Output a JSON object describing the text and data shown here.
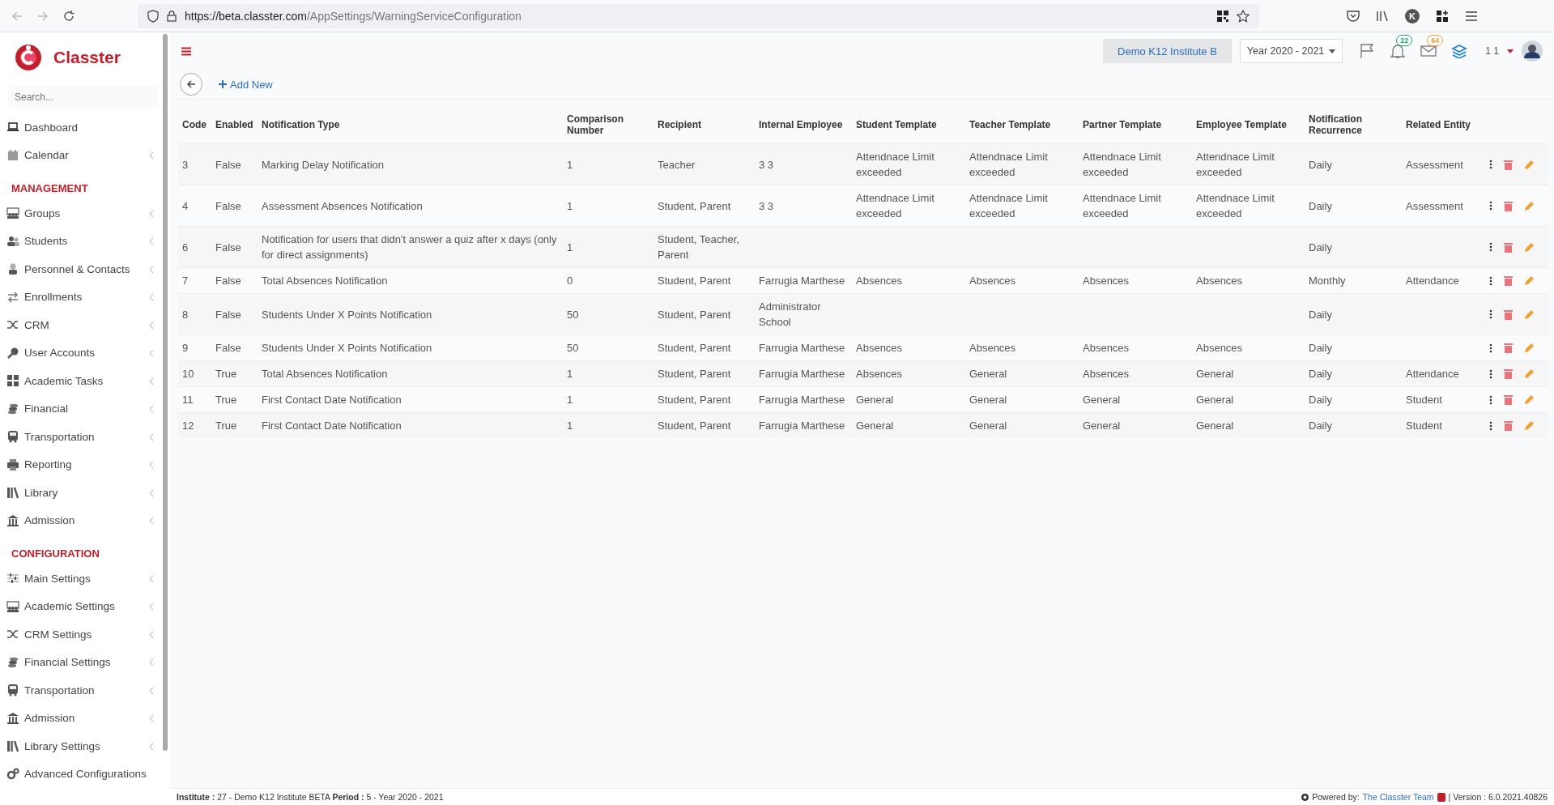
{
  "browser": {
    "url_host": "https://beta.classter.com",
    "url_path": "/AppSettings/WarningServiceConfiguration",
    "profile_initial": "K"
  },
  "sidebar": {
    "brand": "Classter",
    "search_placeholder": "Search...",
    "sections": [
      {
        "items": [
          {
            "label": "Dashboard",
            "expandable": false
          },
          {
            "label": "Calendar",
            "expandable": true
          }
        ]
      },
      {
        "title": "MANAGEMENT",
        "items": [
          {
            "label": "Groups",
            "expandable": true
          },
          {
            "label": "Students",
            "expandable": true
          },
          {
            "label": "Personnel & Contacts",
            "expandable": true
          },
          {
            "label": "Enrollments",
            "expandable": true
          },
          {
            "label": "CRM",
            "expandable": true
          },
          {
            "label": "User Accounts",
            "expandable": true
          },
          {
            "label": "Academic Tasks",
            "expandable": true
          },
          {
            "label": "Financial",
            "expandable": true
          },
          {
            "label": "Transportation",
            "expandable": true
          },
          {
            "label": "Reporting",
            "expandable": true
          },
          {
            "label": "Library",
            "expandable": true
          },
          {
            "label": "Admission",
            "expandable": true
          }
        ]
      },
      {
        "title": "CONFIGURATION",
        "items": [
          {
            "label": "Main Settings",
            "expandable": true
          },
          {
            "label": "Academic Settings",
            "expandable": true
          },
          {
            "label": "CRM Settings",
            "expandable": true
          },
          {
            "label": "Financial Settings",
            "expandable": true
          },
          {
            "label": "Transportation",
            "expandable": true
          },
          {
            "label": "Admission",
            "expandable": true
          },
          {
            "label": "Library Settings",
            "expandable": true
          },
          {
            "label": "Advanced Configurations",
            "expandable": false
          }
        ]
      }
    ]
  },
  "header": {
    "institute": "Demo K12 Institute B",
    "year": "Year 2020 - 2021",
    "notifications": "22",
    "messages": "64",
    "user": "1 1"
  },
  "toolbar": {
    "add_label": "Add New"
  },
  "table": {
    "columns": [
      "Code",
      "Enabled",
      "Notification Type",
      "Comparison Number",
      "Recipient",
      "Internal Employee",
      "Student Template",
      "Teacher Template",
      "Partner Template",
      "Employee Template",
      "Notification Recurrence",
      "Related Entity"
    ],
    "rows": [
      {
        "cells": [
          "3",
          "False",
          "Marking Delay Notification",
          "1",
          "Teacher",
          "3 3",
          "Attendnace Limit exceeded",
          "Attendnace Limit exceeded",
          "Attendnace Limit exceeded",
          "Attendnace Limit exceeded",
          "Daily",
          "Assessment"
        ]
      },
      {
        "cells": [
          "4",
          "False",
          "Assessment Absences Notification",
          "1",
          "Student, Parent",
          "3 3",
          "Attendnace Limit exceeded",
          "Attendnace Limit exceeded",
          "Attendnace Limit exceeded",
          "Attendnace Limit exceeded",
          "Daily",
          "Assessment"
        ]
      },
      {
        "cells": [
          "6",
          "False",
          "Notification for users that didn't answer a quiz after x days (only for direct assignments)",
          "1",
          "Student, Teacher, Parent",
          null,
          null,
          null,
          null,
          null,
          "Daily",
          null
        ]
      },
      {
        "cells": [
          "7",
          "False",
          "Total Absences Notification",
          "0",
          "Student, Parent",
          "Farrugia Marthese",
          "Absences",
          "Absences",
          "Absences",
          "Absences",
          "Monthly",
          "Attendance"
        ]
      },
      {
        "cells": [
          "8",
          "False",
          "Students Under X Points Notification",
          "50",
          "Student, Parent",
          "Administrator School",
          null,
          null,
          null,
          null,
          "Daily",
          null
        ]
      },
      {
        "cells": [
          "9",
          "False",
          "Students Under X Points Notification",
          "50",
          "Student, Parent",
          "Farrugia Marthese",
          "Absences",
          "Absences",
          "Absences",
          "Absences",
          "Daily",
          null
        ]
      },
      {
        "cells": [
          "10",
          "True",
          "Total Absences Notification",
          "1",
          "Student, Parent",
          "Farrugia Marthese",
          "Absences",
          "General",
          "Absences",
          "General",
          "Daily",
          "Attendance"
        ]
      },
      {
        "cells": [
          "11",
          "True",
          "First Contact Date Notification",
          "1",
          "Student, Parent",
          "Farrugia Marthese",
          "General",
          "General",
          "General",
          "General",
          "Daily",
          "Student"
        ]
      },
      {
        "cells": [
          "12",
          "True",
          "First Contact Date Notification",
          "1",
          "Student, Parent",
          "Farrugia Marthese",
          "General",
          "General",
          "General",
          "General",
          "Daily",
          "Student"
        ]
      }
    ]
  },
  "footer": {
    "info": "**Institute :** 27 - Demo K12 Institute BETA **Period :** 5 - Year 2020 - 2021",
    "powered": "Powered by:",
    "team": "The Classter Team",
    "version": "| Version : 6.0.2021.40826"
  }
}
